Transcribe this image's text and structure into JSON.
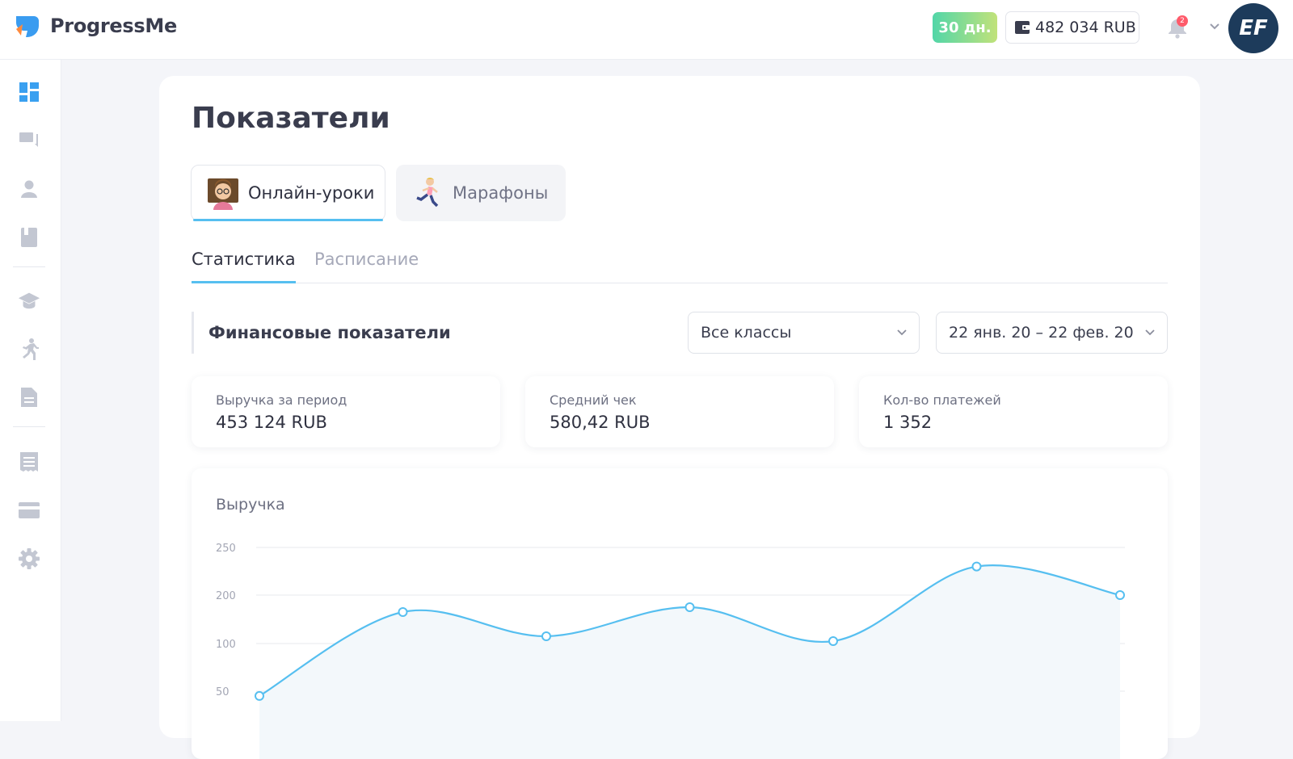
{
  "app": {
    "name": "ProgressMe"
  },
  "header": {
    "trial_badge": "30 дн.",
    "balance": "482 034 RUB",
    "notifications_count": "2",
    "avatar_text": "EF"
  },
  "sidebar": {
    "items": [
      {
        "icon": "dashboard-icon"
      },
      {
        "icon": "chat-icon"
      },
      {
        "icon": "user-icon"
      },
      {
        "icon": "book-icon"
      },
      {
        "icon": "graduation-cap-icon"
      },
      {
        "icon": "runner-icon"
      },
      {
        "icon": "document-icon"
      },
      {
        "icon": "receipt-icon"
      },
      {
        "icon": "card-icon"
      },
      {
        "icon": "gear-icon"
      }
    ]
  },
  "page": {
    "title": "Показатели",
    "mode_tabs": [
      {
        "label": "Онлайн-уроки",
        "active": true
      },
      {
        "label": "Марафоны",
        "active": false
      }
    ],
    "sub_tabs": [
      {
        "label": "Статистика",
        "active": true
      },
      {
        "label": "Расписание",
        "active": false
      }
    ],
    "section_title": "Финансовые показатели",
    "class_filter": "Все классы",
    "date_filter": "22 янв. 20 – 22 фев. 20",
    "stats": [
      {
        "label": "Выручка за период",
        "value": "453 124 RUB"
      },
      {
        "label": "Средний чек",
        "value": "580,42 RUB"
      },
      {
        "label": "Кол-во платежей",
        "value": "1 352"
      }
    ]
  },
  "chart_data": {
    "type": "area",
    "title": "Выручка",
    "y_ticks": [
      "250",
      "200",
      "100",
      "50"
    ],
    "values": [
      45,
      165,
      115,
      175,
      105,
      230,
      200
    ],
    "colors": {
      "line": "#56bff0",
      "fill": "#f3f8fb",
      "grid": "#e7e9ee"
    }
  }
}
